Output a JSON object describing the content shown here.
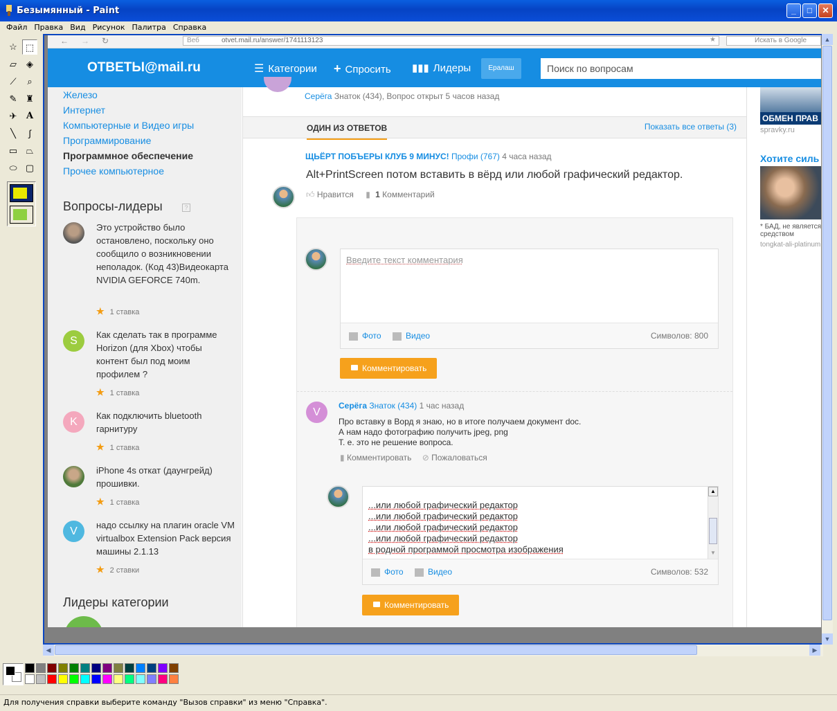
{
  "window": {
    "title": "Безымянный - Paint"
  },
  "menu": [
    "Файл",
    "Правка",
    "Вид",
    "Рисунок",
    "Палитра",
    "Справка"
  ],
  "status_text": "Для получения справки выберите команду \"Вызов справки\" из меню \"Справка\".",
  "browser": {
    "url": "otvet.mail.ru/answer/1741113123",
    "url_prefix": "Веб",
    "google_search": "Искать в Google"
  },
  "site": {
    "logo": "ОТВЕТЫ@mail.ru",
    "nav": {
      "categories": "Категории",
      "ask": "Спросить",
      "leaders": "Лидеры"
    },
    "eralash": "Ералаш",
    "search_placeholder": "Поиск по вопросам"
  },
  "sidebar": {
    "categories": [
      "Железо",
      "Интернет",
      "Компьютерные и Видео игры",
      "Программирование",
      "Программное обеспечение",
      "Прочее компьютерное"
    ],
    "leaders_title": "Вопросы-лидеры",
    "questions": [
      {
        "avatar": "",
        "text": "Это устройство было остановлено, поскольку оно сообщило о возникновении неполадок. (Код 43)Видеокарта NVIDIA GEFORCE 740m.",
        "bets": "1 ставка"
      },
      {
        "avatar": "S",
        "text": "Как сделать так в программе Horizon (для Xbox) чтобы контент был под моим профилем ?",
        "bets": "1 ставка"
      },
      {
        "avatar": "K",
        "text": "Как подключить bluetooth гарнитуру",
        "bets": "1 ставка"
      },
      {
        "avatar": "",
        "text": "iPhone 4s откат (даунгрейд) прошивки.",
        "bets": "1 ставка"
      },
      {
        "avatar": "V",
        "text": "надо ссылку на плагин oracle VM virtualbox Extension Pack версия машины 2.1.13",
        "bets": "2 ставки"
      }
    ],
    "category_leaders_title": "Лидеры категории"
  },
  "question": {
    "author": "Серёга",
    "meta": "Знаток (434), Вопрос открыт 5 часов назад"
  },
  "tabs": {
    "one_answer": "ОДИН ИЗ ОТВЕТОВ",
    "show_all": "Показать все ответы (3)"
  },
  "answer": {
    "author": "ЩЬЁРТ ПОБЪЕРЫ КЛУБ 9 МИНУС!",
    "rank": "Профи (767)",
    "time": "4 часа назад",
    "text": "Alt+PrintScreen потом вставить в вёрд или любой графический редактор.",
    "like": "Нравится",
    "comments_count": "1",
    "comments_label": "Комментарий"
  },
  "comment_form": {
    "placeholder": "Введите текст комментария",
    "photo": "Фото",
    "video": "Видео",
    "chars": "Символов: 800",
    "button": "Комментировать"
  },
  "comment": {
    "avatar": "V",
    "author": "Серёга",
    "rank": "Знаток (434)",
    "time": "1 час назад",
    "lines": [
      "Про вставку в Ворд я знаю, но в итоге получаем документ doc.",
      "А нам надо фотографию получить jpeg, png",
      "Т. е. это не решение вопроса."
    ],
    "reply": "Комментировать",
    "report": "Пожаловаться"
  },
  "reply_form": {
    "lines": [
      "...или любой графический редактор",
      "...или любой графический редактор",
      "...или любой графический редактор",
      "...или любой графический редактор",
      "в родной программой просмотра изображения"
    ],
    "photo": "Фото",
    "video": "Видео",
    "chars": "Символов: 532",
    "button": "Комментировать"
  },
  "ads": {
    "banner_text": "ОБМЕН ПРАВ",
    "source1": "spravky.ru",
    "title2": "Хотите силь",
    "note": "* БАД, не является средством",
    "source2": "tongkat-ali-platinum"
  },
  "colors": {
    "accent": "#168de2",
    "orange": "#f6a11c",
    "xp_blue": "#0a5fe0"
  }
}
